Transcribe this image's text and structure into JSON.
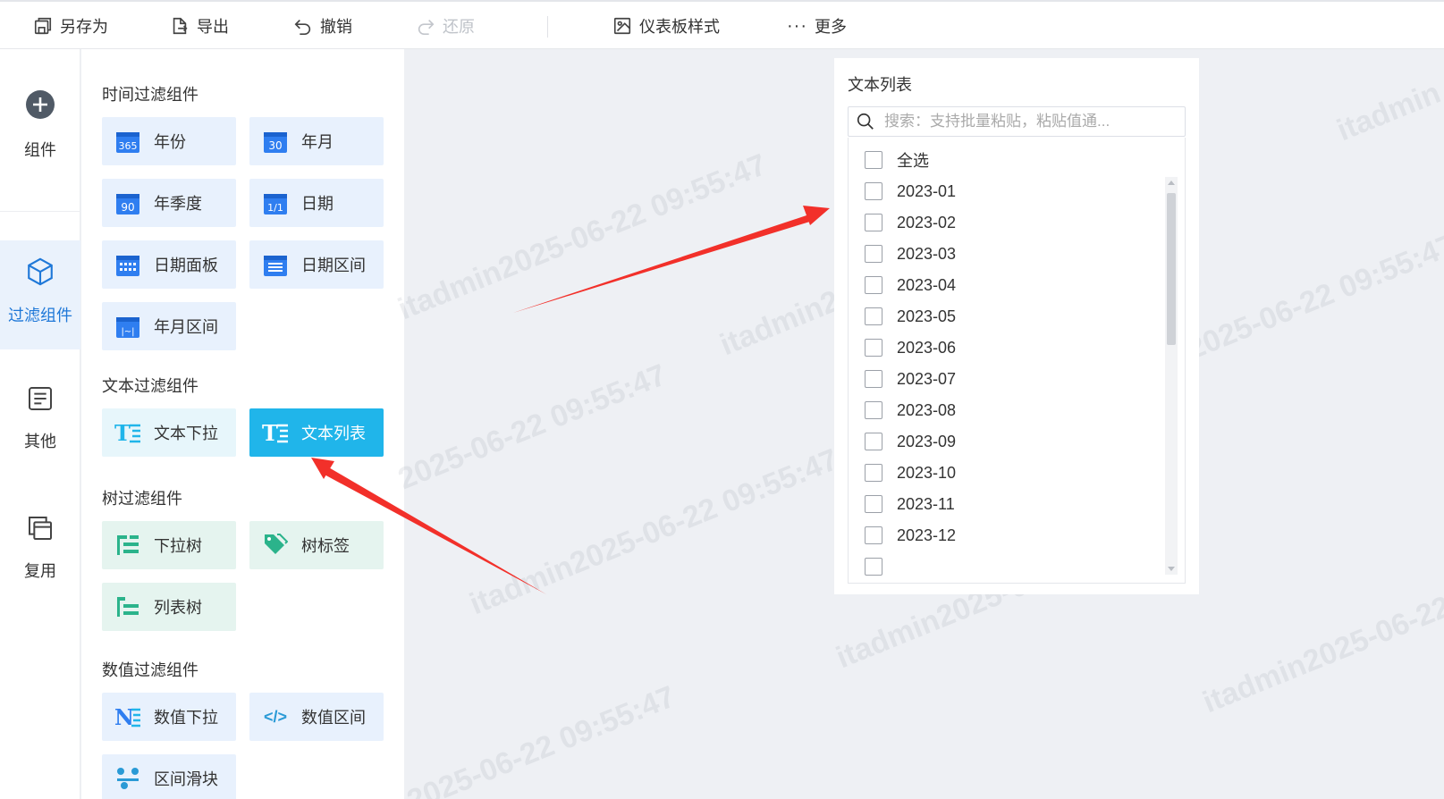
{
  "toolbar": {
    "save_as": "另存为",
    "export": "导出",
    "undo": "撤销",
    "redo": "还原",
    "dashboard_style": "仪表板样式",
    "more": "更多"
  },
  "rail": {
    "items": [
      {
        "label": "组件",
        "icon": "plus-circle-icon"
      },
      {
        "label": "过滤组件",
        "icon": "cube-icon",
        "active": true
      },
      {
        "label": "其他",
        "icon": "document-icon"
      },
      {
        "label": "复用",
        "icon": "copy-icon"
      }
    ]
  },
  "panel": {
    "groups": [
      {
        "title": "时间过滤组件",
        "items": [
          {
            "label": "年份",
            "badge": "365"
          },
          {
            "label": "年月",
            "badge": "30"
          },
          {
            "label": "年季度",
            "badge": "90"
          },
          {
            "label": "日期",
            "badge": "1/1"
          },
          {
            "label": "日期面板",
            "badge": ""
          },
          {
            "label": "日期区间",
            "badge": ""
          },
          {
            "label": "年月区间",
            "badge": "|~|"
          }
        ]
      },
      {
        "title": "文本过滤组件",
        "items": [
          {
            "label": "文本下拉",
            "badge": "T"
          },
          {
            "label": "文本列表",
            "badge": "T",
            "selected": true
          }
        ]
      },
      {
        "title": "树过滤组件",
        "items": [
          {
            "label": "下拉树"
          },
          {
            "label": "树标签"
          },
          {
            "label": "列表树"
          }
        ]
      },
      {
        "title": "数值过滤组件",
        "items": [
          {
            "label": "数值下拉",
            "badge": "N"
          },
          {
            "label": "数值区间",
            "badge": "</>"
          },
          {
            "label": "区间滑块"
          }
        ]
      }
    ]
  },
  "widget": {
    "title": "文本列表",
    "search_placeholder": "搜索：支持批量粘贴，粘贴值通...",
    "select_all": "全选",
    "options": [
      "2023-01",
      "2023-02",
      "2023-03",
      "2023-04",
      "2023-05",
      "2023-06",
      "2023-07",
      "2023-08",
      "2023-09",
      "2023-10",
      "2023-11",
      "2023-12"
    ]
  },
  "watermark": {
    "user": "itadmin",
    "datetime": "2025-06-22 09:55:47",
    "full": "itadmin2025-06-22 09:55:47"
  },
  "colors": {
    "accent": "#1f78d8",
    "selected_card": "#20b5ea",
    "annotation_arrow": "#f2302a"
  }
}
